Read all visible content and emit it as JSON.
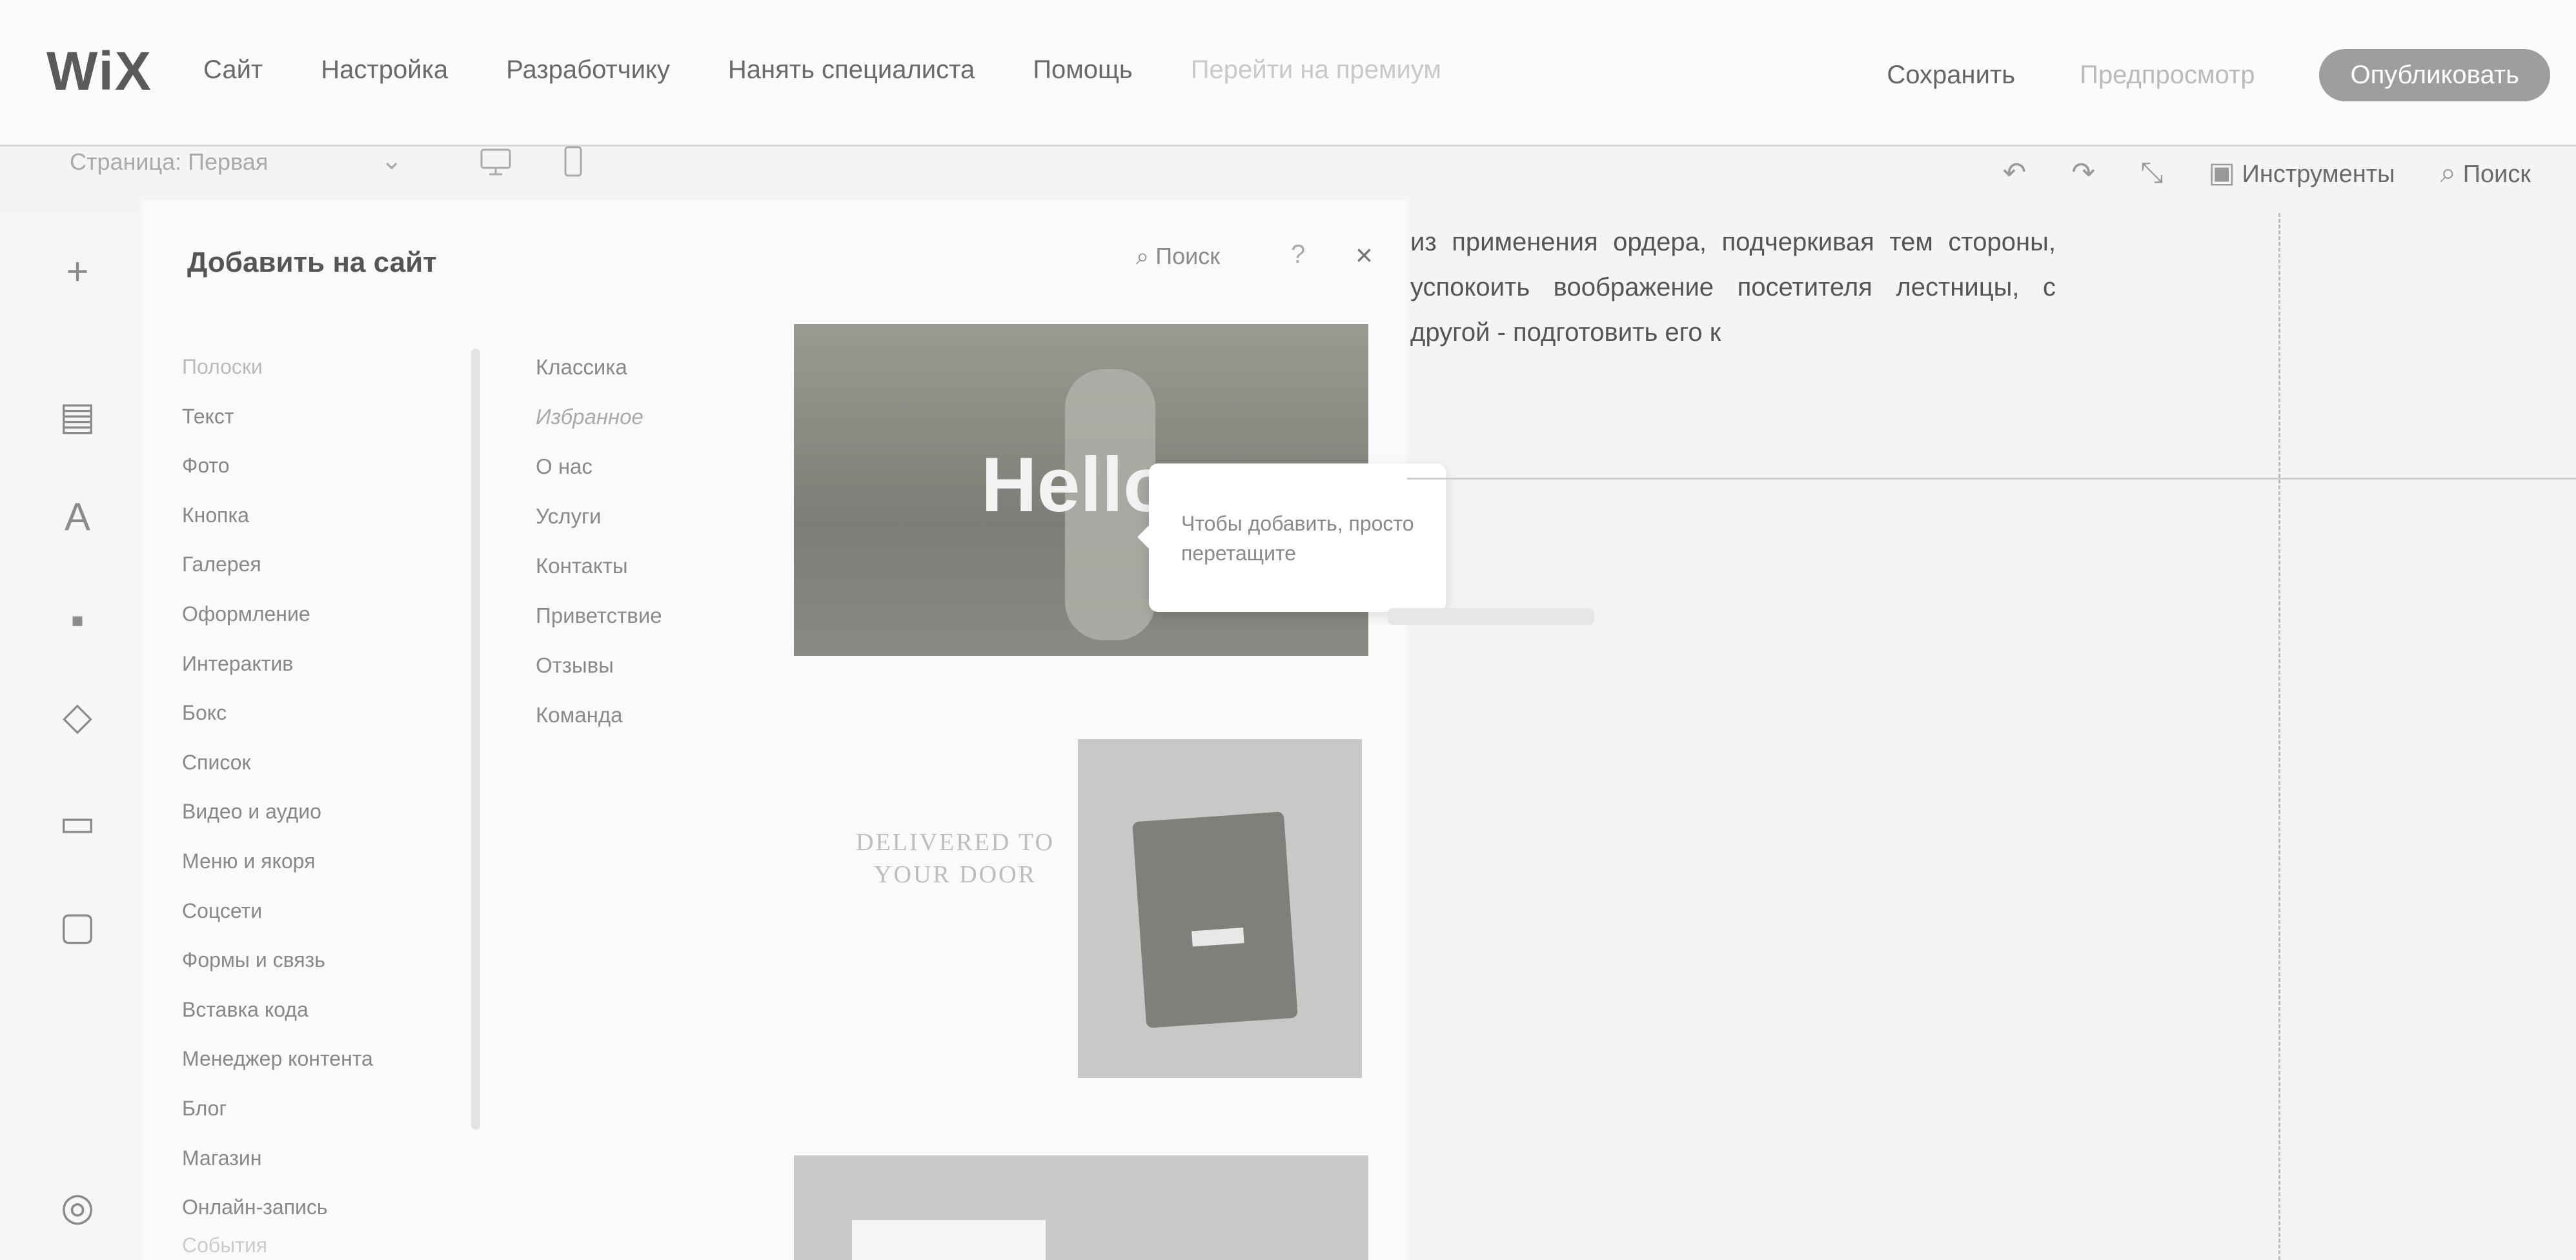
{
  "topbar": {
    "logo": "WiX",
    "menu": [
      "Сайт",
      "Настройка",
      "Разработчику",
      "Нанять специалиста",
      "Помощь",
      "Перейти на премиум"
    ],
    "save": "Сохранить",
    "preview": "Предпросмотр",
    "publish": "Опубликовать"
  },
  "toolbar": {
    "page_selector": "Страница: Первая",
    "tools": "Инструменты",
    "search": "Поиск"
  },
  "left_icons": [
    "add-icon",
    "pages-icon",
    "design-icon",
    "apps-icon",
    "business-icon",
    "media-icon",
    "store-icon",
    "database-icon"
  ],
  "add_panel": {
    "title": "Добавить на сайт",
    "search": "Поиск",
    "help": "?",
    "categories": [
      "Полоски",
      "Текст",
      "Фото",
      "Кнопка",
      "Галерея",
      "Оформление",
      "Интерактив",
      "Бокс",
      "Список",
      "Видео и аудио",
      "Меню и якоря",
      "Соцсети",
      "Формы и связь",
      "Вставка кода",
      "Менеджер контента",
      "Блог",
      "Магазин",
      "Онлайн-запись",
      "События"
    ],
    "subcategories": [
      "Классика",
      "Избранное",
      "О нас",
      "Услуги",
      "Контакты",
      "Приветствие",
      "Отзывы",
      "Команда"
    ],
    "thumb1_text": "Hello",
    "thumb2_text": "DELIVERED TO YOUR DOOR",
    "tooltip": "Чтобы добавить, просто перетащите"
  },
  "canvas": {
    "paragraph": "из применения ордера, подчеркивая тем стороны, успокоить воображение посетителя лестницы, с другой - подготовить его к"
  }
}
